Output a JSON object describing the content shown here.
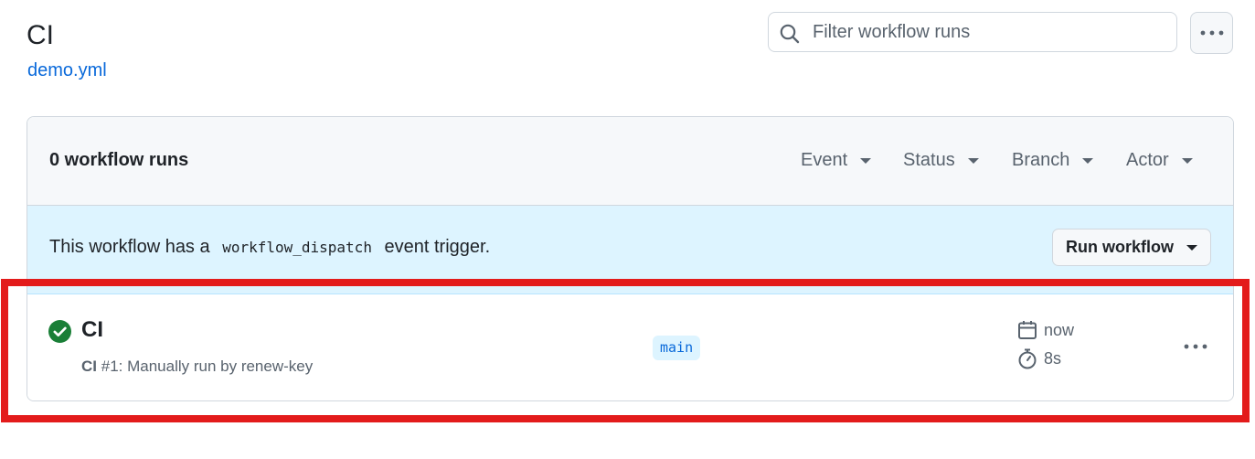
{
  "header": {
    "title": "CI",
    "workflow_file": "demo.yml"
  },
  "search": {
    "placeholder": "Filter workflow runs",
    "value": ""
  },
  "runs_header": {
    "count_label": "0 workflow runs",
    "filters": [
      "Event",
      "Status",
      "Branch",
      "Actor"
    ]
  },
  "dispatch_banner": {
    "text_before": "This workflow has a",
    "code": "workflow_dispatch",
    "text_after": "event trigger.",
    "button_label": "Run workflow"
  },
  "run": {
    "title": "CI",
    "workflow_name": "CI",
    "description": "#1: Manually run by renew-key",
    "branch": "main",
    "time": "now",
    "duration": "8s",
    "status": "success"
  },
  "colors": {
    "link": "#0969da",
    "success": "#1a7f37",
    "highlight": "#e31b1b",
    "banner_bg": "#ddf4ff"
  },
  "icons": [
    "search-icon",
    "kebab-icon",
    "chevron-down-icon",
    "check-circle-icon",
    "calendar-icon",
    "stopwatch-icon"
  ]
}
